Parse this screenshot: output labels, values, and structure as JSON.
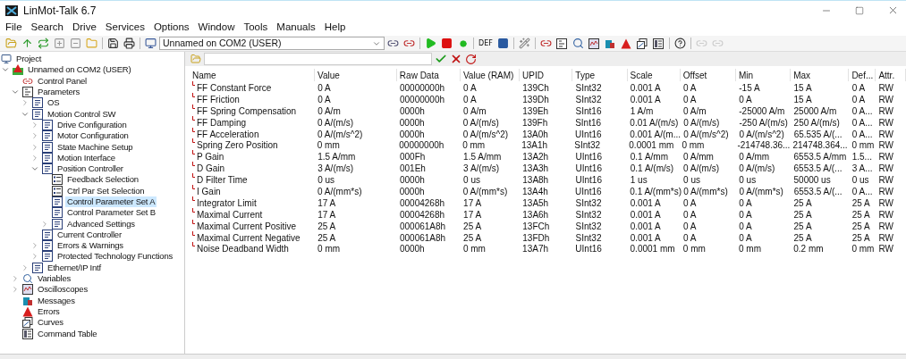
{
  "window": {
    "title": "LinMot-Talk 6.7"
  },
  "menu": [
    "File",
    "Search",
    "Drive",
    "Services",
    "Options",
    "Window",
    "Tools",
    "Manuals",
    "Help"
  ],
  "toolbar": {
    "device_select": "Unnamed on COM2 (USER)",
    "def_button": "DEF"
  },
  "tree": [
    {
      "label": "Project",
      "kind": "project",
      "selected": false,
      "children": [
        {
          "label": "Unnamed on COM2 (USER)",
          "kind": "device",
          "expanded": true,
          "selected": false,
          "children": [
            {
              "label": "Control Panel",
              "kind": "panel",
              "selected": false
            },
            {
              "label": "Parameters",
              "kind": "params",
              "expanded": true,
              "selected": false,
              "children": [
                {
                  "label": "OS",
                  "kind": "list",
                  "expanded": false,
                  "selected": false
                },
                {
                  "label": "Motion Control SW",
                  "kind": "list",
                  "expanded": true,
                  "selected": false,
                  "children": [
                    {
                      "label": "Drive Configuration",
                      "kind": "list",
                      "expanded": false,
                      "selected": false
                    },
                    {
                      "label": "Motor Configuration",
                      "kind": "list",
                      "expanded": false,
                      "selected": false
                    },
                    {
                      "label": "State Machine Setup",
                      "kind": "list",
                      "expanded": false,
                      "selected": false
                    },
                    {
                      "label": "Motion Interface",
                      "kind": "list",
                      "expanded": false,
                      "selected": false
                    },
                    {
                      "label": "Position Controller",
                      "kind": "list",
                      "expanded": true,
                      "selected": false,
                      "children": [
                        {
                          "label": "Feedback Selection",
                          "kind": "choice",
                          "selected": false
                        },
                        {
                          "label": "Ctrl Par Set Selection",
                          "kind": "choice",
                          "selected": false
                        },
                        {
                          "label": "Control Parameter Set A",
                          "kind": "list",
                          "selected": true
                        },
                        {
                          "label": "Control Parameter Set B",
                          "kind": "list",
                          "selected": false
                        },
                        {
                          "label": "Advanced Settings",
                          "kind": "list",
                          "expanded": false,
                          "selected": false
                        }
                      ]
                    },
                    {
                      "label": "Current Controller",
                      "kind": "list",
                      "selected": false
                    },
                    {
                      "label": "Errors & Warnings",
                      "kind": "list",
                      "expanded": false,
                      "selected": false
                    },
                    {
                      "label": "Protected Technology Functions",
                      "kind": "list",
                      "expanded": false,
                      "selected": false
                    }
                  ]
                },
                {
                  "label": "Ethernet/IP Intf",
                  "kind": "list",
                  "expanded": false,
                  "selected": false
                }
              ]
            },
            {
              "label": "Variables",
              "kind": "variables",
              "expanded": false,
              "selected": false
            },
            {
              "label": "Oscilloscopes",
              "kind": "scope",
              "expanded": false,
              "selected": false
            },
            {
              "label": "Messages",
              "kind": "messages",
              "selected": false
            },
            {
              "label": "Errors",
              "kind": "errors",
              "selected": false
            },
            {
              "label": "Curves",
              "kind": "curves",
              "selected": false
            },
            {
              "label": "Command Table",
              "kind": "table",
              "selected": false
            }
          ]
        }
      ]
    }
  ],
  "table": {
    "columns": [
      "Name",
      "Value",
      "Raw Data",
      "Value (RAM)",
      "UPID",
      "Type",
      "Scale",
      "Offset",
      "Min",
      "Max",
      "Def...",
      "Attr."
    ],
    "rows": [
      [
        "FF Constant Force",
        "0 A",
        "00000000h",
        "0 A",
        "139Ch",
        "SInt32",
        "0.001 A",
        "0 A",
        "-15 A",
        "15 A",
        "0 A",
        "RW"
      ],
      [
        "FF Friction",
        "0 A",
        "00000000h",
        "0 A",
        "139Dh",
        "SInt32",
        "0.001 A",
        "0 A",
        "0 A",
        "15 A",
        "0 A",
        "RW"
      ],
      [
        "FF Spring Compensation",
        "0 A/m",
        "0000h",
        "0 A/m",
        "139Eh",
        "SInt16",
        "1 A/m",
        "0 A/m",
        "-25000 A/m",
        "25000 A/m",
        "0 A...",
        "RW"
      ],
      [
        "FF Damping",
        "0 A/(m/s)",
        "0000h",
        "0 A/(m/s)",
        "139Fh",
        "SInt16",
        "0.01 A/(m/s)",
        "0 A/(m/s)",
        "-250 A/(m/s)",
        "250 A/(m/s)",
        "0 A...",
        "RW"
      ],
      [
        "FF Acceleration",
        "0 A/(m/s^2)",
        "0000h",
        "0 A/(m/s^2)",
        "13A0h",
        "UInt16",
        "0.001 A/(m...",
        "0 A/(m/s^2)",
        "0 A/(m/s^2)",
        "65.535 A/(...",
        "0 A...",
        "RW"
      ],
      [
        "Spring Zero Position",
        "0 mm",
        "00000000h",
        "0 mm",
        "13A1h",
        "SInt32",
        "0.0001 mm",
        "0 mm",
        "-214748.36...",
        "214748.364...",
        "0 mm",
        "RW"
      ],
      [
        "P Gain",
        "1.5 A/mm",
        "000Fh",
        "1.5 A/mm",
        "13A2h",
        "UInt16",
        "0.1 A/mm",
        "0 A/mm",
        "0 A/mm",
        "6553.5 A/mm",
        "1.5...",
        "RW"
      ],
      [
        "D Gain",
        "3 A/(m/s)",
        "001Eh",
        "3 A/(m/s)",
        "13A3h",
        "UInt16",
        "0.1 A/(m/s)",
        "0 A/(m/s)",
        "0 A/(m/s)",
        "6553.5 A/(...",
        "3 A...",
        "RW"
      ],
      [
        "D Filter Time",
        "0 us",
        "0000h",
        "0 us",
        "13A8h",
        "UInt16",
        "1 us",
        "0 us",
        "0 us",
        "50000 us",
        "0 us",
        "RW"
      ],
      [
        "I Gain",
        "0 A/(mm*s)",
        "0000h",
        "0 A/(mm*s)",
        "13A4h",
        "UInt16",
        "0.1 A/(mm*s)",
        "0 A/(mm*s)",
        "0 A/(mm*s)",
        "6553.5 A/(...",
        "0 A...",
        "RW"
      ],
      [
        "Integrator Limit",
        "17 A",
        "00004268h",
        "17 A",
        "13A5h",
        "SInt32",
        "0.001 A",
        "0 A",
        "0 A",
        "25 A",
        "25 A",
        "RW"
      ],
      [
        "Maximal Current",
        "17 A",
        "00004268h",
        "17 A",
        "13A6h",
        "SInt32",
        "0.001 A",
        "0 A",
        "0 A",
        "25 A",
        "25 A",
        "RW"
      ],
      [
        "Maximal Current Positive",
        "25 A",
        "000061A8h",
        "25 A",
        "13FCh",
        "SInt32",
        "0.001 A",
        "0 A",
        "0 A",
        "25 A",
        "25 A",
        "RW"
      ],
      [
        "Maximal Current Negative",
        "25 A",
        "000061A8h",
        "25 A",
        "13FDh",
        "SInt32",
        "0.001 A",
        "0 A",
        "0 A",
        "25 A",
        "25 A",
        "RW"
      ],
      [
        "Noise Deadband Width",
        "0 mm",
        "0000h",
        "0 mm",
        "13A7h",
        "UInt16",
        "0.0001 mm",
        "0 mm",
        "0 mm",
        "0.2 mm",
        "0 mm",
        "RW"
      ]
    ]
  }
}
